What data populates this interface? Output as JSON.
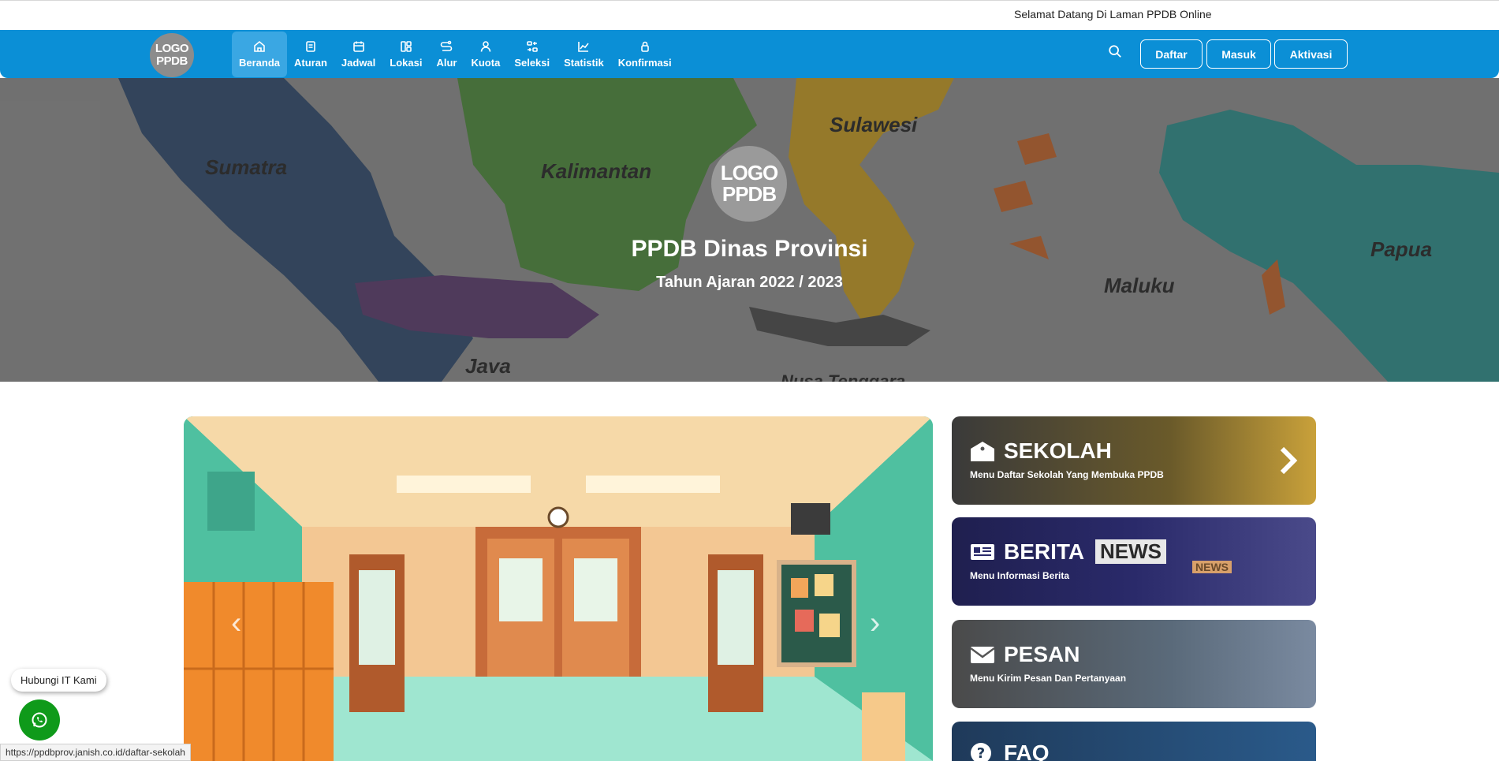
{
  "topbar": {
    "welcome": "Selamat Datang Di Laman PPDB Online"
  },
  "logo": {
    "line1": "LOGO",
    "line2": "PPDB"
  },
  "nav": {
    "items": [
      {
        "label": "Beranda",
        "icon": "home-icon",
        "active": true
      },
      {
        "label": "Aturan",
        "icon": "document-icon"
      },
      {
        "label": "Jadwal",
        "icon": "calendar-icon"
      },
      {
        "label": "Lokasi",
        "icon": "layout-icon"
      },
      {
        "label": "Alur",
        "icon": "flow-icon"
      },
      {
        "label": "Kuota",
        "icon": "user-icon"
      },
      {
        "label": "Seleksi",
        "icon": "sort-icon"
      },
      {
        "label": "Statistik",
        "icon": "chart-icon"
      },
      {
        "label": "Konfirmasi",
        "icon": "lock-icon"
      }
    ],
    "buttons": {
      "daftar": "Daftar",
      "masuk": "Masuk",
      "aktivasi": "Aktivasi"
    }
  },
  "hero": {
    "title": "PPDB Dinas Provinsi",
    "subtitle": "Tahun Ajaran 2022 / 2023",
    "map_labels": {
      "sumatra": "Sumatra",
      "kalimantan": "Kalimantan",
      "sulawesi": "Sulawesi",
      "papua": "Papua",
      "maluku": "Maluku",
      "java": "Java",
      "nusa": "Nusa Tenggara"
    }
  },
  "carousel": {
    "prev": "‹",
    "next": "›"
  },
  "cards": [
    {
      "title": "SEKOLAH",
      "desc": "Menu Daftar Sekolah Yang Membuka PPDB",
      "icon": "school-icon"
    },
    {
      "title": "BERITA",
      "desc": "Menu Informasi Berita",
      "icon": "newspaper-icon",
      "overlay": "NEWS",
      "overlay_small": "NEWS"
    },
    {
      "title": "PESAN",
      "desc": "Menu Kirim Pesan Dan Pertanyaan",
      "icon": "envelope-icon"
    },
    {
      "title": "FAQ",
      "icon": "question-icon"
    }
  ],
  "contact": {
    "label": "Hubungi IT Kami"
  },
  "status_url": "https://ppdbprov.janish.co.id/daftar-sekolah",
  "colors": {
    "navbar": "#0b8fd6",
    "whatsapp": "#0f9a1a"
  }
}
